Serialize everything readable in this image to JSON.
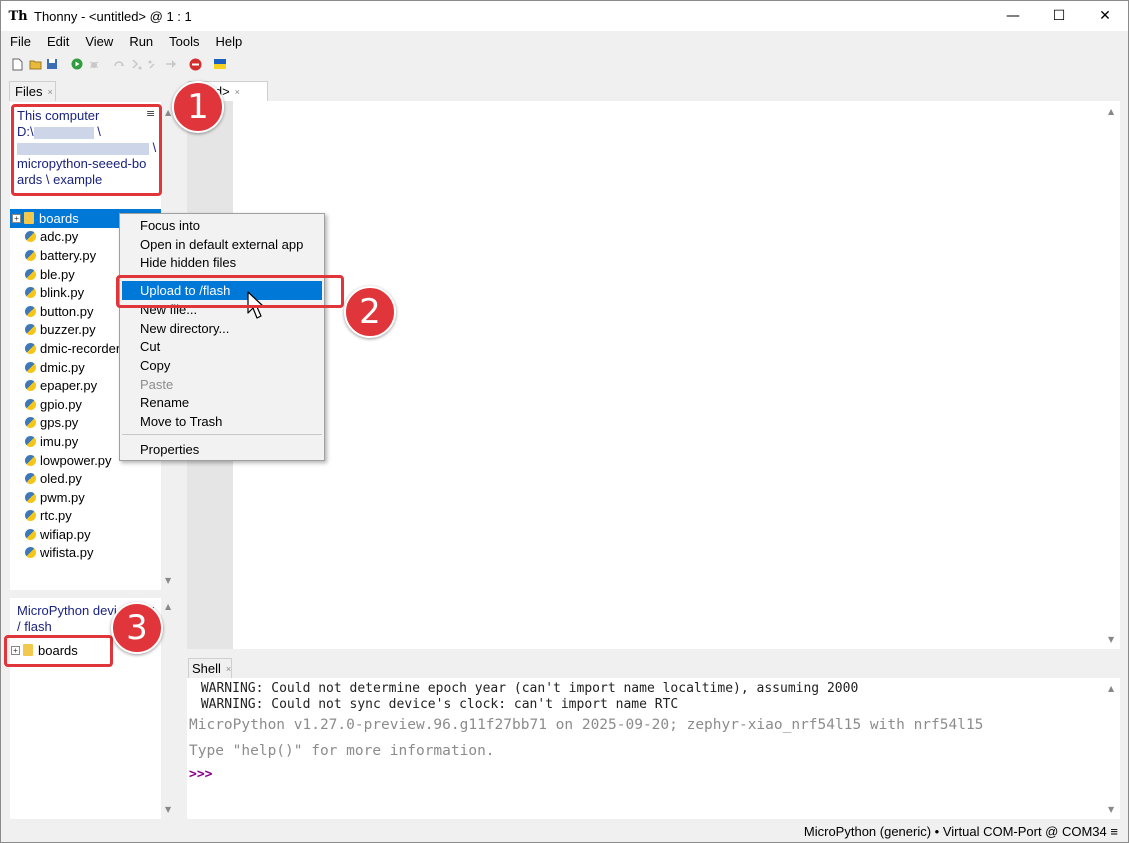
{
  "window": {
    "title": "Thonny  -  <untitled>  @  1 : 1",
    "app_icon": "Th",
    "minimize": "—",
    "maximize": "☐",
    "close": "✕"
  },
  "menubar": [
    "File",
    "Edit",
    "View",
    "Run",
    "Tools",
    "Help"
  ],
  "files_panel": {
    "tab_label": "Files",
    "tab_close": "×",
    "local": {
      "title": "This computer",
      "path_line1": "D:\\",
      "path_sep1": "\\",
      "path_sep2": "\\",
      "path_line3": "micropython-seeed-bo",
      "path_line4": "ards \\ example",
      "menu_glyph": "≡",
      "items": [
        {
          "name": "boards",
          "kind": "folder",
          "selected": true
        },
        {
          "name": "adc.py",
          "kind": "py"
        },
        {
          "name": "battery.py",
          "kind": "py"
        },
        {
          "name": "ble.py",
          "kind": "py"
        },
        {
          "name": "blink.py",
          "kind": "py"
        },
        {
          "name": "button.py",
          "kind": "py"
        },
        {
          "name": "buzzer.py",
          "kind": "py"
        },
        {
          "name": "dmic-recorder",
          "kind": "py"
        },
        {
          "name": "dmic.py",
          "kind": "py"
        },
        {
          "name": "epaper.py",
          "kind": "py"
        },
        {
          "name": "gpio.py",
          "kind": "py"
        },
        {
          "name": "gps.py",
          "kind": "py"
        },
        {
          "name": "imu.py",
          "kind": "py"
        },
        {
          "name": "lowpower.py",
          "kind": "py"
        },
        {
          "name": "oled.py",
          "kind": "py"
        },
        {
          "name": "pwm.py",
          "kind": "py"
        },
        {
          "name": "rtc.py",
          "kind": "py"
        },
        {
          "name": "wifiap.py",
          "kind": "py"
        },
        {
          "name": "wifista.py",
          "kind": "py"
        }
      ]
    },
    "device": {
      "title": "MicroPython devi",
      "path": "/ flash",
      "menu_glyph": "≡",
      "items": [
        {
          "name": "boards",
          "kind": "folder"
        }
      ]
    }
  },
  "editor": {
    "tab_label": "ıtitled>",
    "tab_close": "×"
  },
  "context_menu": {
    "items": [
      {
        "label": "Focus into",
        "state": "normal"
      },
      {
        "label": "Open in default external app",
        "state": "normal"
      },
      {
        "label": "Hide hidden files",
        "state": "normal"
      },
      {
        "label": "Upload to /flash",
        "state": "highlighted"
      },
      {
        "label": "New file...",
        "state": "normal"
      },
      {
        "label": "New directory...",
        "state": "normal"
      },
      {
        "label": "Cut",
        "state": "normal"
      },
      {
        "label": "Copy",
        "state": "normal"
      },
      {
        "label": "Paste",
        "state": "disabled"
      },
      {
        "label": "Rename",
        "state": "normal"
      },
      {
        "label": "Move to Trash",
        "state": "normal"
      },
      {
        "label": "Properties",
        "state": "normal"
      }
    ]
  },
  "shell": {
    "tab_label": "Shell",
    "tab_close": "×",
    "warning1": " WARNING: Could not determine epoch year (can't import name localtime), assuming 2000",
    "warning2": " WARNING: Could not sync device's clock: can't import name RTC",
    "banner": "MicroPython v1.27.0-preview.96.g11f27bb71 on 2025-09-20; zephyr-xiao_nrf54l15 with nrf54l15",
    "help": "Type \"help()\" for more information.",
    "prompt": ">>>"
  },
  "annotations": {
    "badge1": "1",
    "badge2": "2",
    "badge3": "3",
    "color": "#e0353b"
  },
  "status": {
    "text": "MicroPython (generic)  •  Virtual COM-Port @ COM34",
    "menu_glyph": "≡"
  },
  "colors": {
    "selection": "#0078d7",
    "path_text": "#1a237e",
    "prompt": "#8b008b",
    "shell_gray": "#8c8c8c"
  }
}
